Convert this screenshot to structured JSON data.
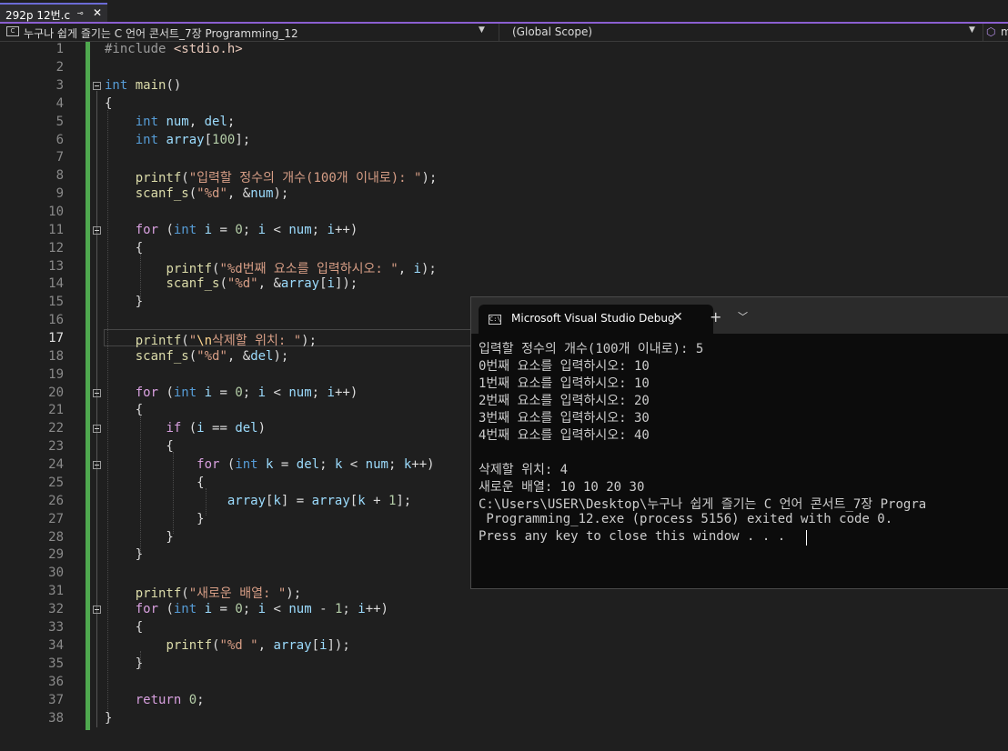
{
  "tab": {
    "title": "292p 12번.c",
    "pin": "⊸",
    "close": "✕"
  },
  "nav": {
    "project_icon": "c-file-icon",
    "project": "누구나 쉽게 즐기는 C 언어 콘서트_7장 Programming_12",
    "scope": "(Global Scope)",
    "member_icon": "cube-icon",
    "member": "m"
  },
  "editor": {
    "active_line": 17,
    "lines": [
      "1",
      "2",
      "3",
      "4",
      "5",
      "6",
      "7",
      "8",
      "9",
      "10",
      "11",
      "12",
      "13",
      "14",
      "15",
      "16",
      "17",
      "18",
      "19",
      "20",
      "21",
      "22",
      "23",
      "24",
      "25",
      "26",
      "27",
      "28",
      "29",
      "30",
      "31",
      "32",
      "33",
      "34",
      "35",
      "36",
      "37",
      "38"
    ]
  },
  "colors": {
    "change_bar": "#4fa84f",
    "tab_accent": "#8b5fd1",
    "keyword": "#569cd6",
    "control": "#d8a0df",
    "function": "#dcdcaa",
    "string": "#d69d85",
    "variable": "#9cdcfe",
    "number": "#b5cea8"
  },
  "console": {
    "title": "Microsoft Visual Studio Debug",
    "new_tab": "+",
    "dropdown": "﹀",
    "close": "✕",
    "output": [
      "입력할 정수의 개수(100개 이내로): 5",
      "0번째 요소를 입력하시오: 10",
      "1번째 요소를 입력하시오: 10",
      "2번째 요소를 입력하시오: 20",
      "3번째 요소를 입력하시오: 30",
      "4번째 요소를 입력하시오: 40",
      "",
      "삭제할 위치: 4",
      "새로운 배열: 10 10 20 30",
      "C:\\Users\\USER\\Desktop\\누구나 쉽게 즐기는 C 언어 콘서트_7장 Progra",
      " Programming_12.exe (process 5156) exited with code 0.",
      "Press any key to close this window . . ."
    ]
  }
}
